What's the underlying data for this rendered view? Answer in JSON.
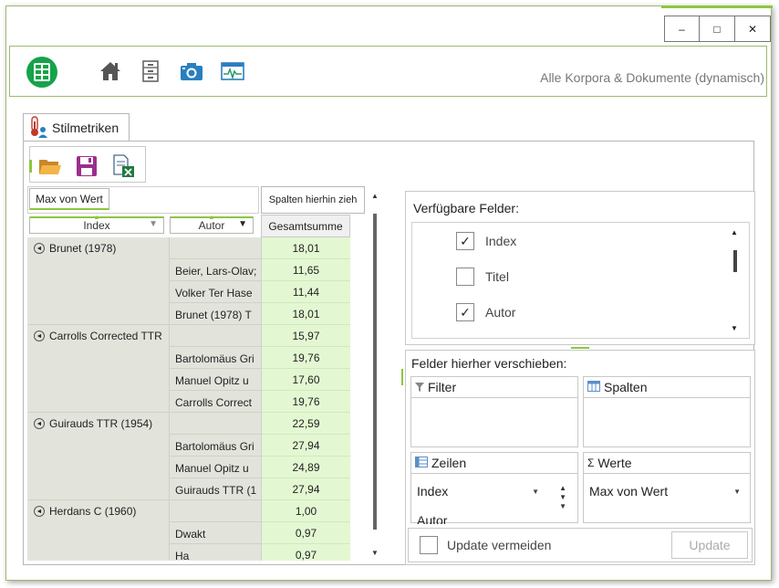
{
  "window": {
    "minimize": "‒",
    "maximize": "□",
    "close": "✕"
  },
  "header": {
    "title": "Alle Korpora & Dokumente (dynamisch)",
    "icons": [
      "app-logo-icon",
      "home-icon",
      "cabinet-icon",
      "camera-icon",
      "monitor-chart-icon"
    ]
  },
  "tab": {
    "label": "Stilmetriken",
    "icon": "thermometer-user-icon"
  },
  "toolbar": {
    "icons": [
      "open-folder-icon",
      "save-icon",
      "export-excel-icon"
    ]
  },
  "pivot": {
    "data_field": "Max von Wert",
    "column_hint": "Spalten hierhin zieh",
    "row_fields": [
      "Index",
      "Autor"
    ],
    "grand_total": "Gesamtsumme",
    "groups": [
      {
        "name": "Brunet (1978)",
        "total": "18,01",
        "rows": [
          {
            "sub": "Beier, Lars-Olav;",
            "val": "11,65"
          },
          {
            "sub": "Volker Ter Hase",
            "val": "11,44"
          },
          {
            "sub": "Brunet (1978) T",
            "val": "18,01"
          }
        ]
      },
      {
        "name": "Carrolls Corrected TTR",
        "total": "15,97",
        "rows": [
          {
            "sub": "Bartolomäus Gri",
            "val": "19,76"
          },
          {
            "sub": "Manuel Opitz u",
            "val": "17,60"
          },
          {
            "sub": "Carrolls Correct",
            "val": "19,76"
          }
        ]
      },
      {
        "name": "Guirauds TTR (1954)",
        "total": "22,59",
        "rows": [
          {
            "sub": "Bartolomäus Gri",
            "val": "27,94"
          },
          {
            "sub": "Manuel Opitz u",
            "val": "24,89"
          },
          {
            "sub": "Guirauds TTR (1",
            "val": "27,94"
          }
        ]
      },
      {
        "name": "Herdans C (1960)",
        "total": "1,00",
        "rows": [
          {
            "sub": "Dwakt",
            "val": "0,97"
          },
          {
            "sub": "Ha",
            "val": "0,97"
          }
        ]
      }
    ]
  },
  "field_list": {
    "title": "Verfügbare Felder:",
    "items": [
      {
        "label": "Index",
        "checked": true
      },
      {
        "label": "Titel",
        "checked": false
      },
      {
        "label": "Autor",
        "checked": true
      }
    ],
    "check": "✓"
  },
  "drop_zones": {
    "title": "Felder hierher verschieben:",
    "filter": "Filter",
    "columns": "Spalten",
    "rows": "Zeilen",
    "values": "Werte",
    "values_symbol": "Σ",
    "row_items": [
      "Index",
      "Autor"
    ],
    "value_items": [
      "Max von Wert"
    ]
  },
  "footer": {
    "defer_label": "Update vermeiden",
    "update_button": "Update"
  },
  "colors": {
    "accent": "#8dc63f",
    "value_cell": "#e3f8d2",
    "row_header": "#e2e4dc",
    "logo": "#16a34a"
  }
}
